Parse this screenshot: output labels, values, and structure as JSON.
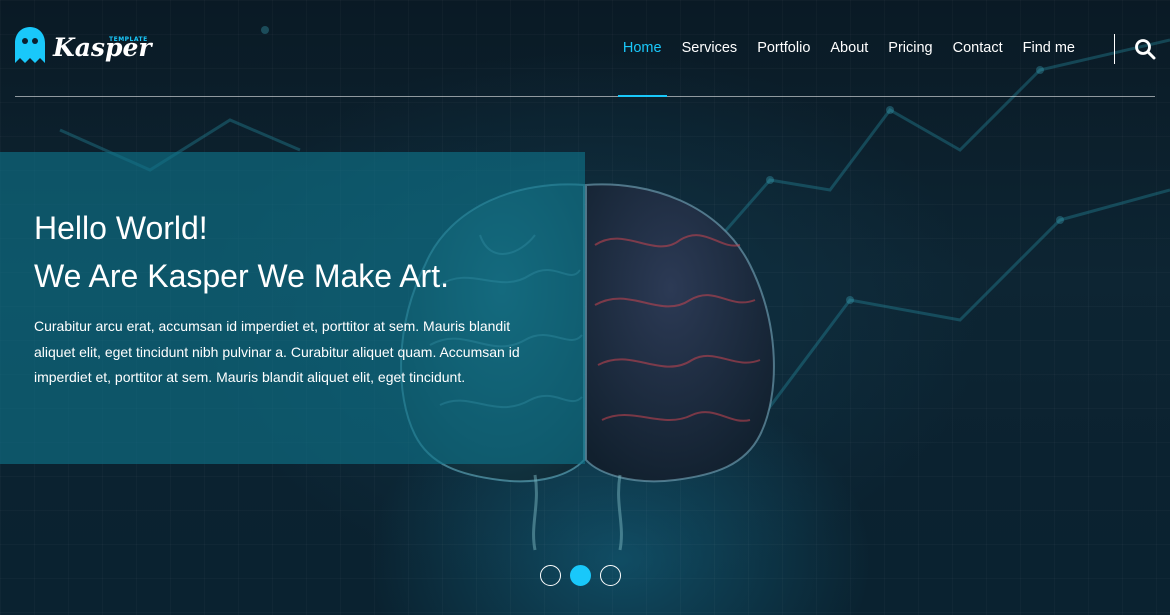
{
  "brand": {
    "name": "Kasper",
    "tagline": "TEMPLATE",
    "accent": "#19c8fa"
  },
  "nav": {
    "items": [
      {
        "label": "Home",
        "active": true
      },
      {
        "label": "Services"
      },
      {
        "label": "Portfolio"
      },
      {
        "label": "About"
      },
      {
        "label": "Pricing"
      },
      {
        "label": "Contact"
      },
      {
        "label": "Find me"
      }
    ],
    "search_icon": "search-icon"
  },
  "hero": {
    "title_line1": "Hello World!",
    "title_line2": "We Are Kasper We Make Art.",
    "body": "Curabitur arcu erat, accumsan id imperdiet et, porttitor at sem. Mauris blandit aliquet elit, eget tincidunt nibh pulvinar a. Curabitur aliquet quam. Accumsan id imperdiet et, porttitor at sem. Mauris blandit aliquet elit, eget tincidunt."
  },
  "slider": {
    "count": 3,
    "active_index": 1
  }
}
